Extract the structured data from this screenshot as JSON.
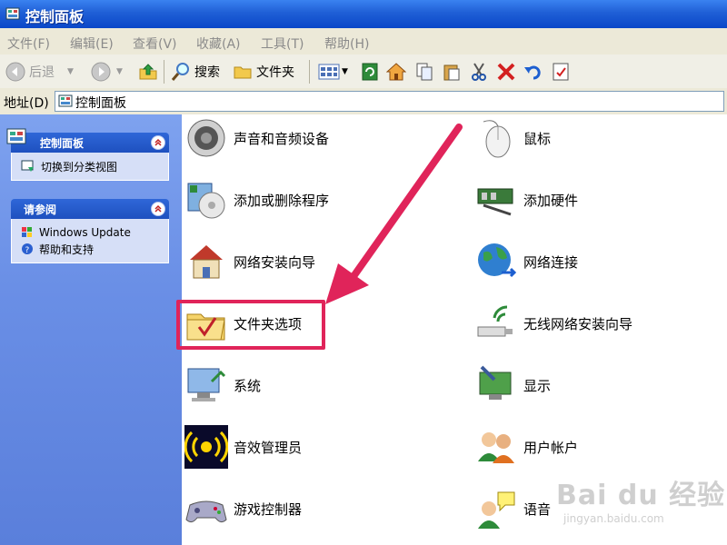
{
  "window": {
    "title": "控制面板"
  },
  "menu": [
    "文件(F)",
    "编辑(E)",
    "查看(V)",
    "收藏(A)",
    "工具(T)",
    "帮助(H)"
  ],
  "toolbar": {
    "back_label": "后退",
    "search_label": "搜索",
    "folders_label": "文件夹"
  },
  "address": {
    "label": "地址(D)",
    "value": "控制面板"
  },
  "sidebar": {
    "panel1": {
      "title": "控制面板",
      "items": [
        "切换到分类视图"
      ]
    },
    "panel2": {
      "title": "请参阅",
      "items": [
        "Windows Update",
        "帮助和支持"
      ]
    }
  },
  "items": [
    {
      "label": "声音和音频设备",
      "icon": "speaker-icon"
    },
    {
      "label": "鼠标",
      "icon": "mouse-icon"
    },
    {
      "label": "添加或删除程序",
      "icon": "add-remove-programs-icon"
    },
    {
      "label": "添加硬件",
      "icon": "add-hardware-icon"
    },
    {
      "label": "网络安装向导",
      "icon": "network-setup-icon"
    },
    {
      "label": "网络连接",
      "icon": "network-connections-icon"
    },
    {
      "label": "文件夹选项",
      "icon": "folder-options-icon"
    },
    {
      "label": "无线网络安装向导",
      "icon": "wireless-network-icon"
    },
    {
      "label": "系统",
      "icon": "system-icon"
    },
    {
      "label": "显示",
      "icon": "display-icon"
    },
    {
      "label": "音效管理员",
      "icon": "sound-manager-icon"
    },
    {
      "label": "用户帐户",
      "icon": "user-accounts-icon"
    },
    {
      "label": "游戏控制器",
      "icon": "game-controller-icon"
    },
    {
      "label": "语音",
      "icon": "speech-icon"
    }
  ],
  "watermark": {
    "brand": "Bai du 经验",
    "url": "jingyan.baidu.com"
  },
  "colors": {
    "highlight": "#e0245a",
    "titlebar": "#1f5fd6",
    "sidebar": "#6a8fe6"
  }
}
